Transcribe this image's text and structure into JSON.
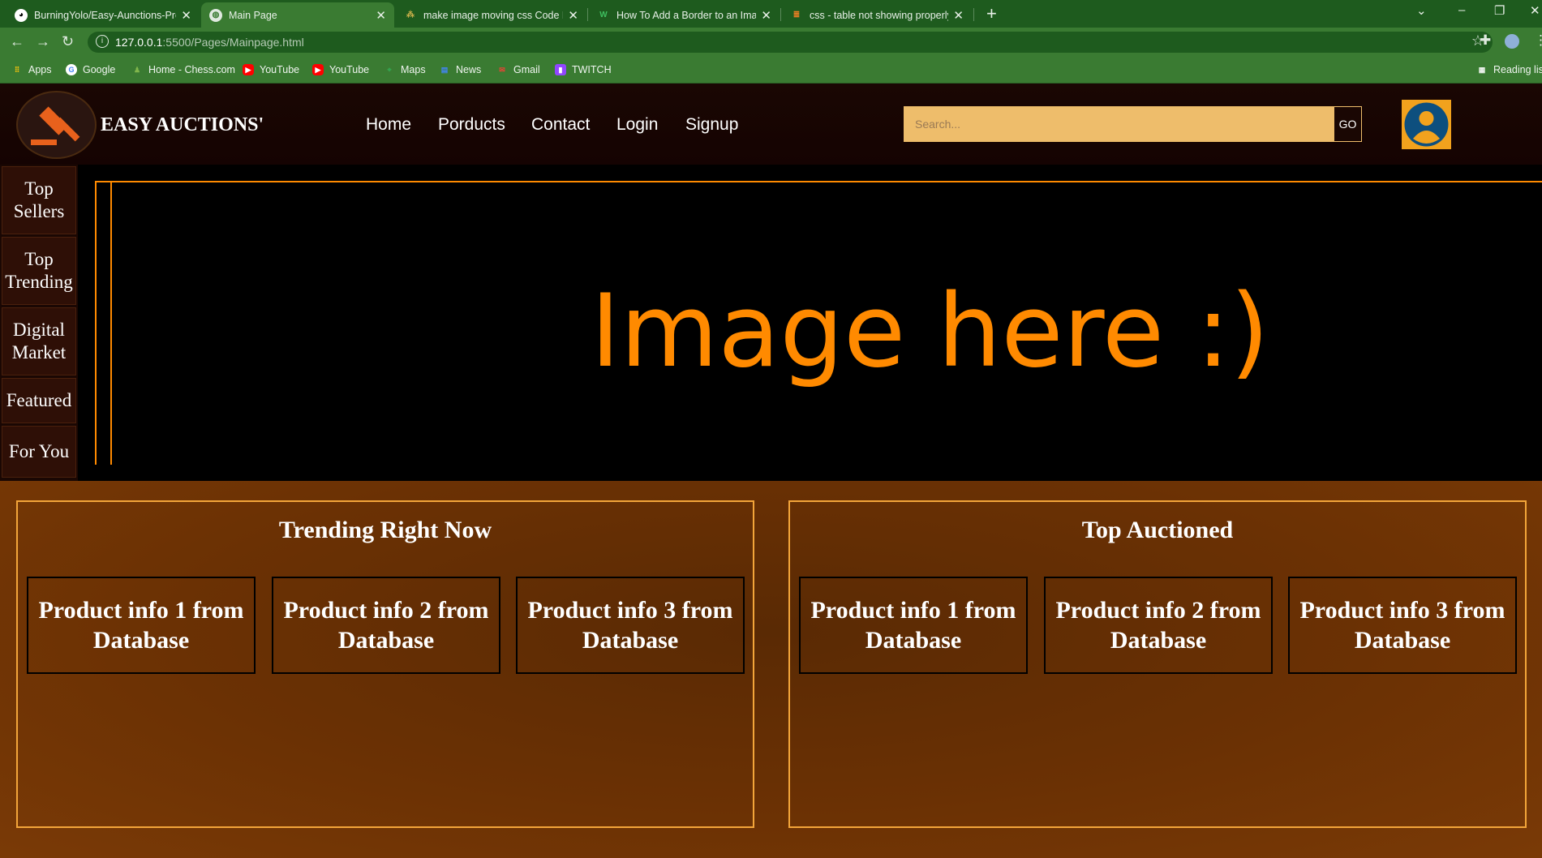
{
  "browser": {
    "tabs": [
      {
        "title": "BurningYolo/Easy-Aunctions-Pro",
        "favicon": "github-icon",
        "active": false
      },
      {
        "title": "Main Page",
        "favicon": "globe-icon",
        "active": true
      },
      {
        "title": "make image moving css Code Ex",
        "favicon": "grepper-icon",
        "active": false
      },
      {
        "title": "How To Add a Border to an Imag",
        "favicon": "w3schools-icon",
        "active": false
      },
      {
        "title": "css - table not showing properly",
        "favicon": "stackoverflow-icon",
        "active": false
      }
    ],
    "url_host": "127.0.0.1",
    "url_rest": ":5500/Pages/Mainpage.html",
    "bookmarks": [
      "Apps",
      "Google",
      "Home - Chess.com",
      "YouTube",
      "YouTube",
      "Maps",
      "News",
      "Gmail",
      "TWITCH"
    ],
    "reading_list": "Reading lis"
  },
  "header": {
    "brand": "EASY AUCTIONS'",
    "nav": [
      "Home",
      "Porducts",
      "Contact",
      "Login",
      "Signup"
    ],
    "search_placeholder": "Search...",
    "search_button": "GO"
  },
  "sidebar": {
    "items": [
      "Top Sellers",
      "Top Trending",
      "Digital Market",
      "Featured",
      "For You"
    ]
  },
  "hero": {
    "text": "Image here :)"
  },
  "sections": [
    {
      "title": "Trending Right Now",
      "cards": [
        "Product info 1 from Database",
        "Product info 2 from Database",
        "Product info 3 from Database"
      ]
    },
    {
      "title": "Top Auctioned",
      "cards": [
        "Product info 1 from Database",
        "Product info 2 from Database",
        "Product info 3 from Database"
      ]
    }
  ],
  "colors": {
    "accent": "#ff8a00",
    "search_bg": "#eebd6b",
    "chrome_dark": "#1e5b1e",
    "chrome_light": "#3a7b32",
    "content_bg": "#6b3104"
  }
}
